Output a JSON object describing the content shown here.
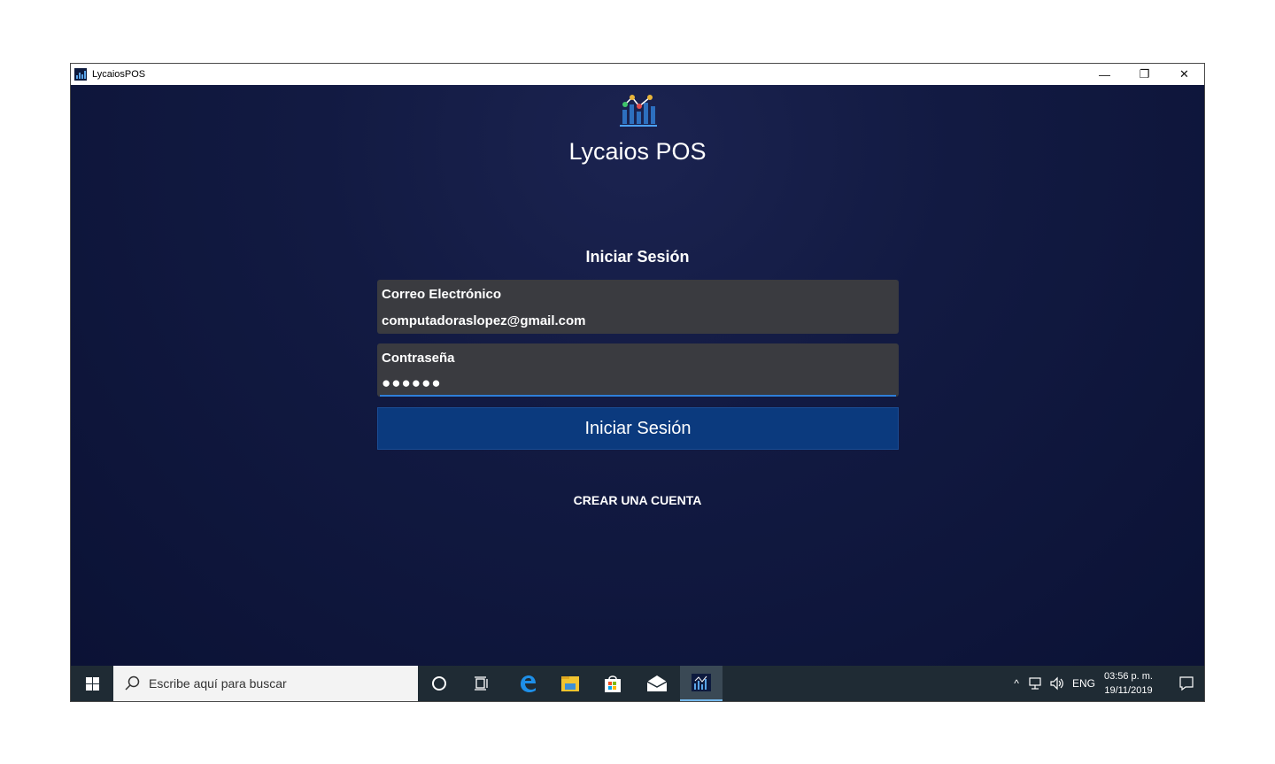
{
  "window": {
    "title": "LycaiosPOS",
    "controls": {
      "minimize": "—",
      "restore": "❐",
      "close": "✕"
    }
  },
  "app": {
    "name": "Lycaios POS",
    "section_title": "Iniciar Sesión",
    "email": {
      "label": "Correo Electrónico",
      "value": "computadoraslopez@gmail.com"
    },
    "password": {
      "label": "Contraseña",
      "value": "●●●●●●"
    },
    "login_button": "Iniciar Sesión",
    "create_account": "CREAR UNA CUENTA"
  },
  "taskbar": {
    "search_placeholder": "Escribe aquí para buscar",
    "tray": {
      "chevron": "^",
      "language": "ENG",
      "time": "03:56 p. m.",
      "date": "19/11/2019"
    }
  },
  "colors": {
    "background": "#121a42",
    "field": "#3a3b40",
    "button": "#0b3a7e",
    "accent": "#2f7fd9",
    "taskbar": "#1f2b34"
  }
}
